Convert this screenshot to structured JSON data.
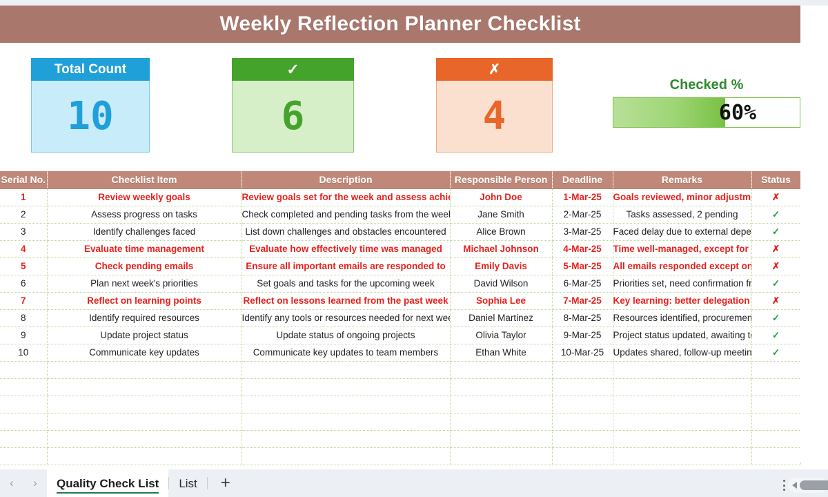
{
  "title": "Weekly Reflection Planner Checklist",
  "kpis": {
    "total": {
      "label": "Total Count",
      "value": "10"
    },
    "checked": {
      "label": "✓",
      "value": "6"
    },
    "unchecked": {
      "label": "✗",
      "value": "4"
    },
    "percent": {
      "label": "Checked %",
      "value": "60%",
      "fill": 60
    }
  },
  "table": {
    "headers": [
      "Serial No.",
      "Checklist Item",
      "Description",
      "Responsible Person",
      "Deadline",
      "Remarks",
      "Status"
    ],
    "rows": [
      {
        "sn": "1",
        "item": "Review weekly goals",
        "desc": "Review goals set for the week and assess achievement",
        "person": "John Doe",
        "deadline": "1-Mar-25",
        "remarks": "Goals reviewed, minor adjustments needed",
        "status": "✗",
        "checked": false
      },
      {
        "sn": "2",
        "item": "Assess progress on tasks",
        "desc": "Check completed and pending tasks from the week",
        "person": "Jane Smith",
        "deadline": "2-Mar-25",
        "remarks": "Tasks assessed, 2 pending",
        "status": "✓",
        "checked": true
      },
      {
        "sn": "3",
        "item": "Identify challenges faced",
        "desc": "List down challenges and obstacles encountered",
        "person": "Alice Brown",
        "deadline": "3-Mar-25",
        "remarks": "Faced delay due to external dependency",
        "status": "✓",
        "checked": true
      },
      {
        "sn": "4",
        "item": "Evaluate time management",
        "desc": "Evaluate how effectively time was managed",
        "person": "Michael Johnson",
        "deadline": "4-Mar-25",
        "remarks": "Time well-managed, except for one urgent task",
        "status": "✗",
        "checked": false
      },
      {
        "sn": "5",
        "item": "Check pending emails",
        "desc": "Ensure all important emails are responded to",
        "person": "Emily Davis",
        "deadline": "5-Mar-25",
        "remarks": "All emails responded except one awaiting info",
        "status": "✗",
        "checked": false
      },
      {
        "sn": "6",
        "item": "Plan next week's priorities",
        "desc": "Set goals and tasks for the upcoming week",
        "person": "David Wilson",
        "deadline": "6-Mar-25",
        "remarks": "Priorities set, need confirmation from manager",
        "status": "✓",
        "checked": true
      },
      {
        "sn": "7",
        "item": "Reflect on learning points",
        "desc": "Reflect on lessons learned from the past week",
        "person": "Sophia Lee",
        "deadline": "7-Mar-25",
        "remarks": "Key learning: better delegation needed",
        "status": "✗",
        "checked": false
      },
      {
        "sn": "8",
        "item": "Identify required resources",
        "desc": "Identify any tools or resources needed for next week",
        "person": "Daniel Martinez",
        "deadline": "8-Mar-25",
        "remarks": "Resources identified, procurement requested",
        "status": "✓",
        "checked": true
      },
      {
        "sn": "9",
        "item": "Update project status",
        "desc": "Update status of ongoing projects",
        "person": "Olivia Taylor",
        "deadline": "9-Mar-25",
        "remarks": "Project status updated, awaiting team feedback",
        "status": "✓",
        "checked": true
      },
      {
        "sn": "10",
        "item": "Communicate key updates",
        "desc": "Communicate key updates to team members",
        "person": "Ethan White",
        "deadline": "10-Mar-25",
        "remarks": "Updates shared, follow-up meeting scheduled",
        "status": "✓",
        "checked": true
      }
    ],
    "empty_rows": 6
  },
  "tabbar": {
    "prev": "‹",
    "next": "›",
    "tabs": [
      {
        "label": "Quality Check List",
        "active": true
      },
      {
        "label": "List",
        "active": false
      }
    ],
    "add": "+"
  }
}
